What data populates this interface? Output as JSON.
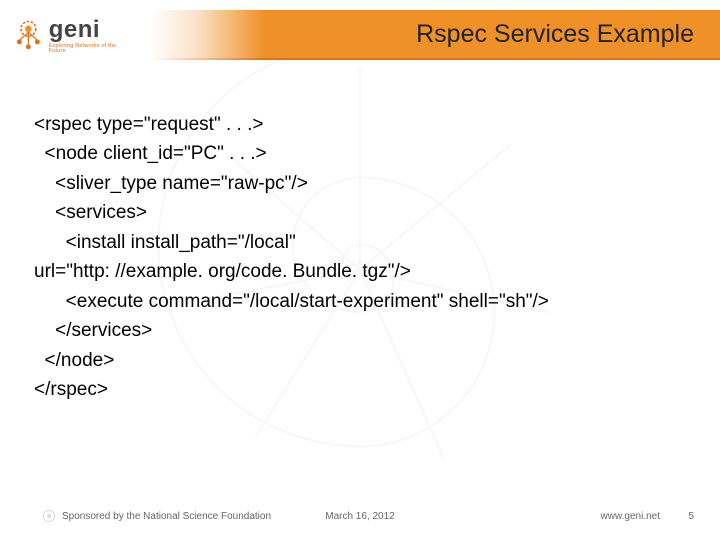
{
  "logo": {
    "word": "geni",
    "tagline": "Exploring Networks of the Future"
  },
  "title": "Rspec Services Example",
  "code": {
    "l1": "<rspec type=\"request\" . . .>",
    "l2": "  <node client_id=\"PC\" . . .>",
    "l3": "    <sliver_type name=\"raw-pc\"/>",
    "l4": "    <services>",
    "l5": "      <install install_path=\"/local\"",
    "l6": "url=\"http: //example. org/code. Bundle. tgz\"/>",
    "l7": "      <execute command=\"/local/start-experiment\" shell=\"sh\"/>",
    "l8": "    </services>",
    "l9": "  </node>",
    "l10": "</rspec>"
  },
  "footer": {
    "sponsor": "Sponsored by the National Science Foundation",
    "date": "March 16, 2012",
    "site": "www.geni.net",
    "page": "5"
  }
}
